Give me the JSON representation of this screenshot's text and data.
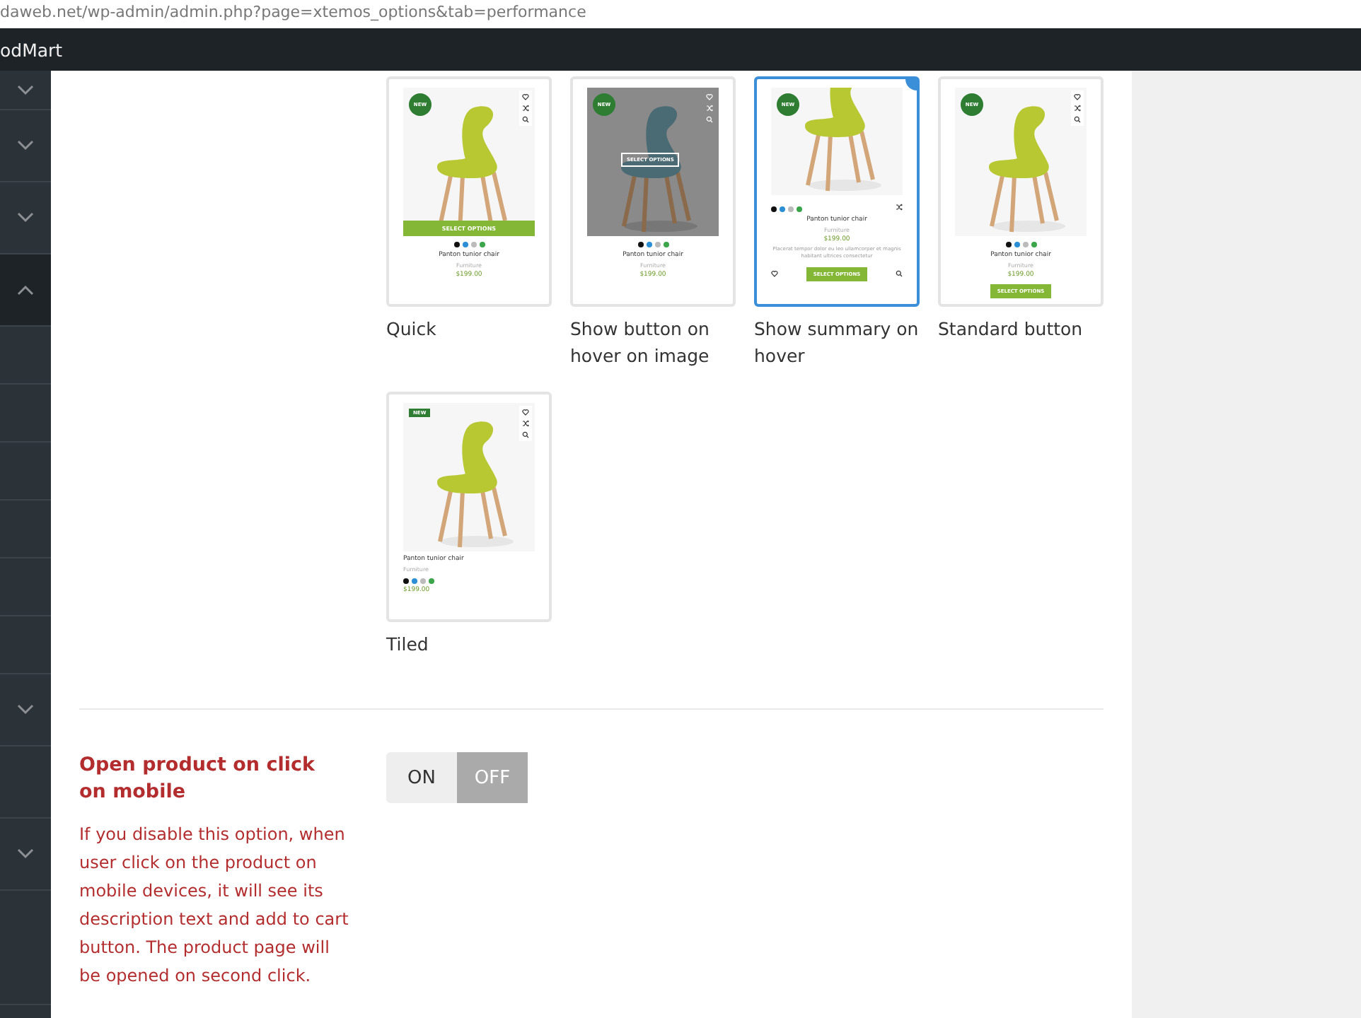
{
  "browser": {
    "url": "daweb.net/wp-admin/admin.php?page=xtemos_options&tab=performance"
  },
  "admin_bar": {
    "site_name": "odMart"
  },
  "sidebar": {
    "items": [
      {
        "kind": "group",
        "expanded": false
      },
      {
        "kind": "group",
        "expanded": false
      },
      {
        "kind": "group",
        "expanded": false
      },
      {
        "kind": "group",
        "expanded": true
      },
      {
        "kind": "link"
      },
      {
        "kind": "link"
      },
      {
        "kind": "link"
      },
      {
        "kind": "link"
      },
      {
        "kind": "link"
      },
      {
        "kind": "link"
      },
      {
        "kind": "group",
        "expanded": false
      },
      {
        "kind": "link"
      },
      {
        "kind": "group",
        "expanded": false
      },
      {
        "kind": "link"
      }
    ]
  },
  "hover_options": [
    {
      "kind": "quick",
      "label": "Quick",
      "selected": false,
      "badge": "NEW",
      "button": "SELECT OPTIONS",
      "name": "Panton tunior chair",
      "category": "Furniture",
      "price": "$199.00",
      "swatches": [
        {
          "color": "#111111"
        },
        {
          "color": "#2b8fd6"
        },
        {
          "color": "#bbbbbb"
        },
        {
          "color": "#3aa54a"
        }
      ]
    },
    {
      "kind": "hover-image",
      "label": "Show button on hover on image",
      "selected": false,
      "badge": "NEW",
      "button": "SELECT OPTIONS",
      "name": "Panton tunior chair",
      "category": "Furniture",
      "price": "$199.00",
      "swatches": [
        {
          "color": "#111111"
        },
        {
          "color": "#2b8fd6"
        },
        {
          "color": "#bbbbbb"
        },
        {
          "color": "#3aa54a"
        }
      ]
    },
    {
      "kind": "summary",
      "label": "Show summary on hover",
      "selected": true,
      "badge": "NEW",
      "button": "SELECT OPTIONS",
      "name": "Panton tunior chair",
      "category": "Furniture",
      "price": "$199.00",
      "description": "Placerat tempor dolor eu leo ullamcorper et magnis habitant ultrices consectetur",
      "swatches": [
        {
          "color": "#111111"
        },
        {
          "color": "#2b8fd6"
        },
        {
          "color": "#bbbbbb"
        },
        {
          "color": "#3aa54a"
        }
      ]
    },
    {
      "kind": "standard",
      "label": "Standard button",
      "selected": false,
      "badge": "NEW",
      "button": "SELECT OPTIONS",
      "name": "Panton tunior chair",
      "category": "Furniture",
      "price": "$199.00",
      "swatches": [
        {
          "color": "#111111"
        },
        {
          "color": "#2b8fd6"
        },
        {
          "color": "#bbbbbb"
        },
        {
          "color": "#3aa54a"
        }
      ]
    },
    {
      "kind": "tiled",
      "label": "Tiled",
      "selected": false,
      "badge": "NEW",
      "name": "Panton tunior chair",
      "category": "Furniture",
      "price": "$199.00",
      "swatches": [
        {
          "color": "#111111"
        },
        {
          "color": "#2b8fd6"
        },
        {
          "color": "#bbbbbb"
        },
        {
          "color": "#3aa54a"
        }
      ]
    }
  ],
  "open_on_click": {
    "title": "Open product on click on mobile",
    "description": "If you disable this option, when user click on the product on mobile devices, it will see its description text and add to cart button. The product page will be opened on second click.",
    "on_label": "ON",
    "off_label": "OFF",
    "on": false
  }
}
